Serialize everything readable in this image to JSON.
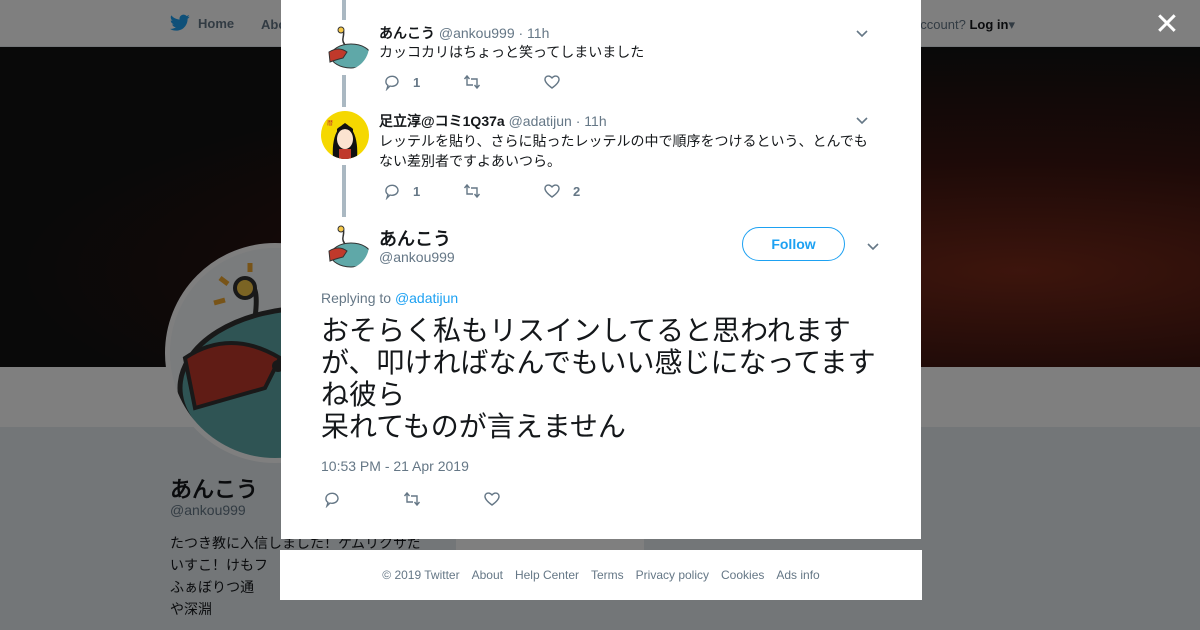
{
  "nav": {
    "home": "Home",
    "about": "Abo",
    "account_prompt": "account?",
    "login": "Log in"
  },
  "profile": {
    "name": "あんこう",
    "handle": "@ankou999",
    "bio": "たつき教に入信しました！ケムリクサだいすこ！けもフ　　　　　　　　　よ！ ふぁぼりつ通　　　　　　　　　はもはや深淵",
    "card_text": "Ads info"
  },
  "tweets": [
    {
      "name": "あんこう",
      "handle": "@ankou999",
      "time": "· 11h",
      "text": "カッコカリはちょっと笑ってしまいました",
      "replies": "1",
      "retweets": "",
      "likes": ""
    },
    {
      "name": "足立淳@コミ1Q37a",
      "handle": "@adatijun",
      "time": "· 11h",
      "text": "レッテルを貼り、さらに貼ったレッテルの中で順序をつけるという、とんでもない差別者ですよあいつら。",
      "replies": "1",
      "retweets": "",
      "likes": "2"
    }
  ],
  "main_tweet": {
    "name": "あんこう",
    "handle": "@ankou999",
    "follow_label": "Follow",
    "replying_prefix": "Replying to",
    "replying_to": "@adatijun",
    "text": "おそらく私もリスインしてると思われますが、叩ければなんでもいい感じになってますね彼ら\n呆れてものが言えません",
    "timestamp": "10:53 PM - 21 Apr 2019"
  },
  "footer": [
    "© 2019 Twitter",
    "About",
    "Help Center",
    "Terms",
    "Privacy policy",
    "Cookies",
    "Ads info"
  ],
  "colors": {
    "accent": "#1da1f2",
    "thread": "#aab8c2",
    "muted": "#657786"
  }
}
